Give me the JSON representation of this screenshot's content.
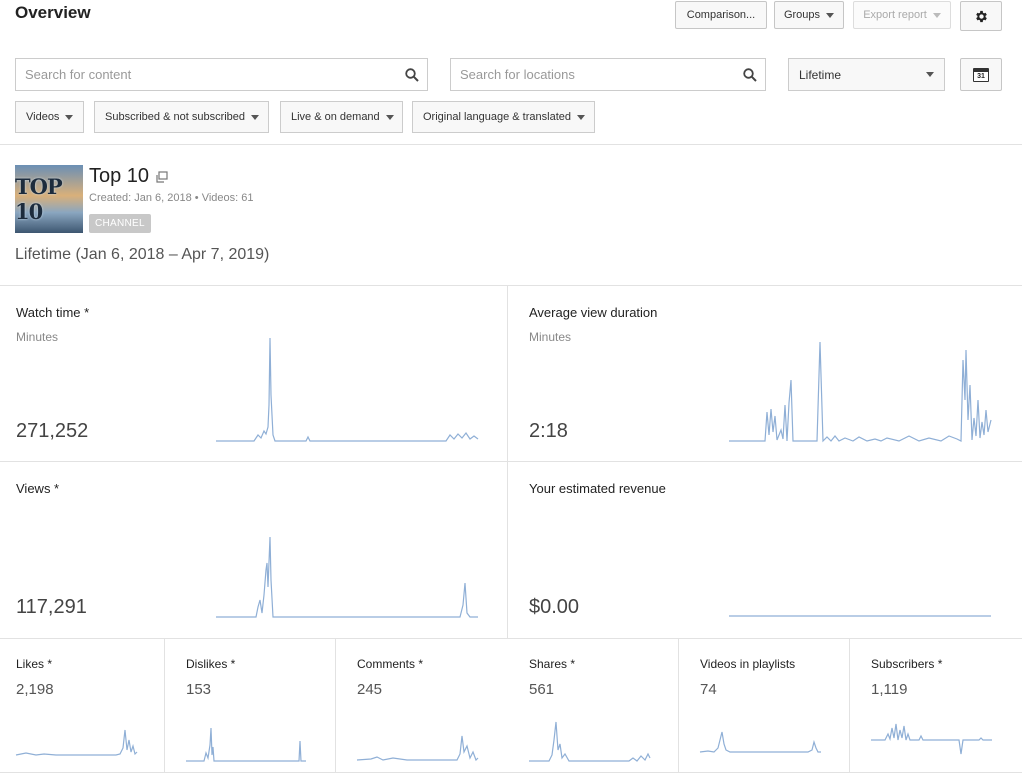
{
  "header": {
    "title": "Overview",
    "comparison_label": "Comparison...",
    "groups_label": "Groups",
    "export_label": "Export report"
  },
  "filters": {
    "content_search_placeholder": "Search for content",
    "location_search_placeholder": "Search for locations",
    "date_range": "Lifetime",
    "calendar_day": "31",
    "chips": [
      "Videos",
      "Subscribed & not subscribed",
      "Live & on demand",
      "Original language & translated"
    ]
  },
  "channel": {
    "thumbnail_text": "TOP 10",
    "name": "Top 10",
    "meta": "Created: Jan 6, 2018 • Videos: 61",
    "badge": "CHANNEL",
    "range": "Lifetime (Jan 6, 2018 – Apr 7, 2019)"
  },
  "metrics": {
    "watch_time": {
      "title": "Watch time *",
      "unit": "Minutes",
      "value": "271,252"
    },
    "avg_view_duration": {
      "title": "Average view duration",
      "unit": "Minutes",
      "value": "2:18"
    },
    "views": {
      "title": "Views *",
      "value": "117,291"
    },
    "revenue": {
      "title": "Your estimated revenue",
      "value": "$0.00"
    },
    "small": [
      {
        "title": "Likes *",
        "value": "2,198"
      },
      {
        "title": "Dislikes *",
        "value": "153"
      },
      {
        "title": "Comments *",
        "value": "245"
      },
      {
        "title": "Shares *",
        "value": "561"
      },
      {
        "title": "Videos in playlists",
        "value": "74"
      },
      {
        "title": "Subscribers *",
        "value": "1,119"
      }
    ]
  },
  "colors": {
    "sparkline": "#8fafd6",
    "button_bg": "#f8f8f8"
  }
}
